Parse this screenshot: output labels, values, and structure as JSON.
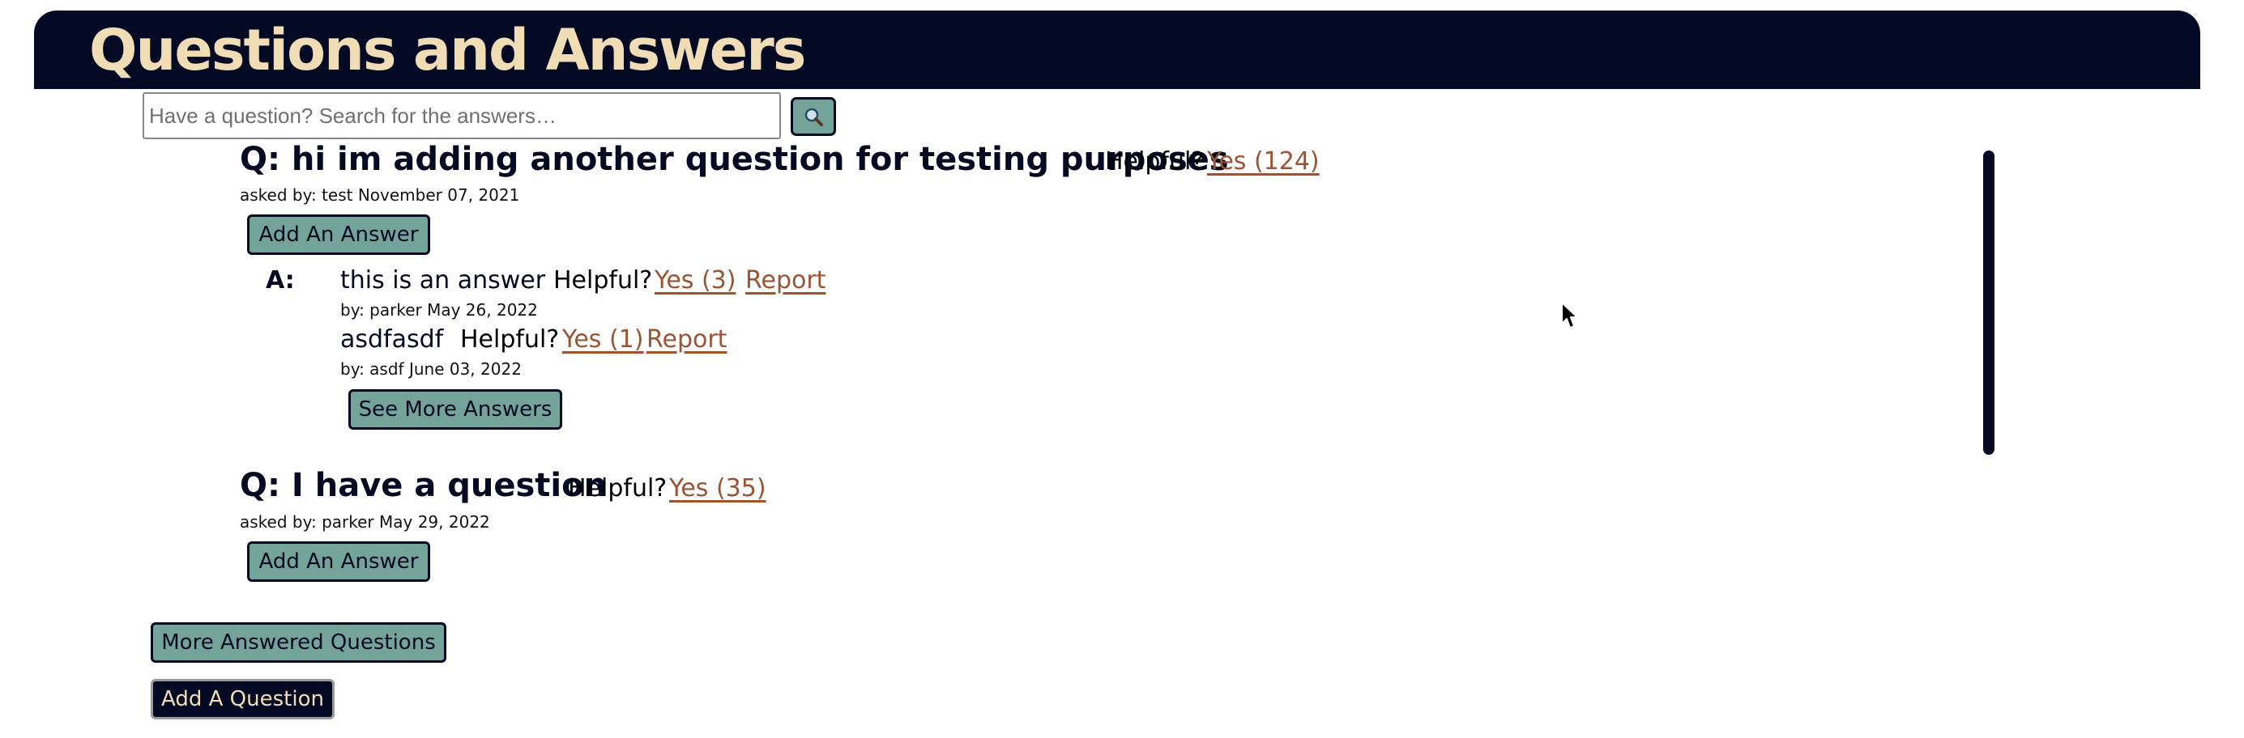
{
  "header": {
    "title": "Questions and Answers"
  },
  "search": {
    "placeholder": "Have a question? Search for the answers…",
    "button_icon": "search-icon"
  },
  "questions": [
    {
      "title": "Q: hi im adding another question for testing purposes",
      "helpful_label": "Helpful?",
      "helpful_link": "Yes (124)",
      "asked_by": "asked by: test November 07, 2021",
      "add_answer_label": "Add An Answer",
      "answers_label": "A:",
      "answers": [
        {
          "body": "this is an answer",
          "helpful_label": "Helpful?",
          "helpful_link": "Yes (3)",
          "report_label": "Report",
          "by": "by: parker May 26, 2022"
        },
        {
          "body": "asdfasdf",
          "helpful_label": "Helpful?",
          "helpful_link": "Yes (1)",
          "report_label": "Report",
          "by": "by: asdf June 03, 2022"
        }
      ],
      "see_more_label": "See More Answers"
    },
    {
      "title": "Q: I have a question",
      "helpful_label": "Helpful?",
      "helpful_link": "Yes (35)",
      "asked_by": "asked by: parker May 29, 2022",
      "add_answer_label": "Add An Answer"
    }
  ],
  "footer": {
    "more_questions_label": "More Answered Questions",
    "add_question_label": "Add A Question"
  },
  "colors": {
    "navy": "#040a24",
    "cream": "#f0ddb5",
    "teal": "#74a39a",
    "link": "#9a5534"
  }
}
